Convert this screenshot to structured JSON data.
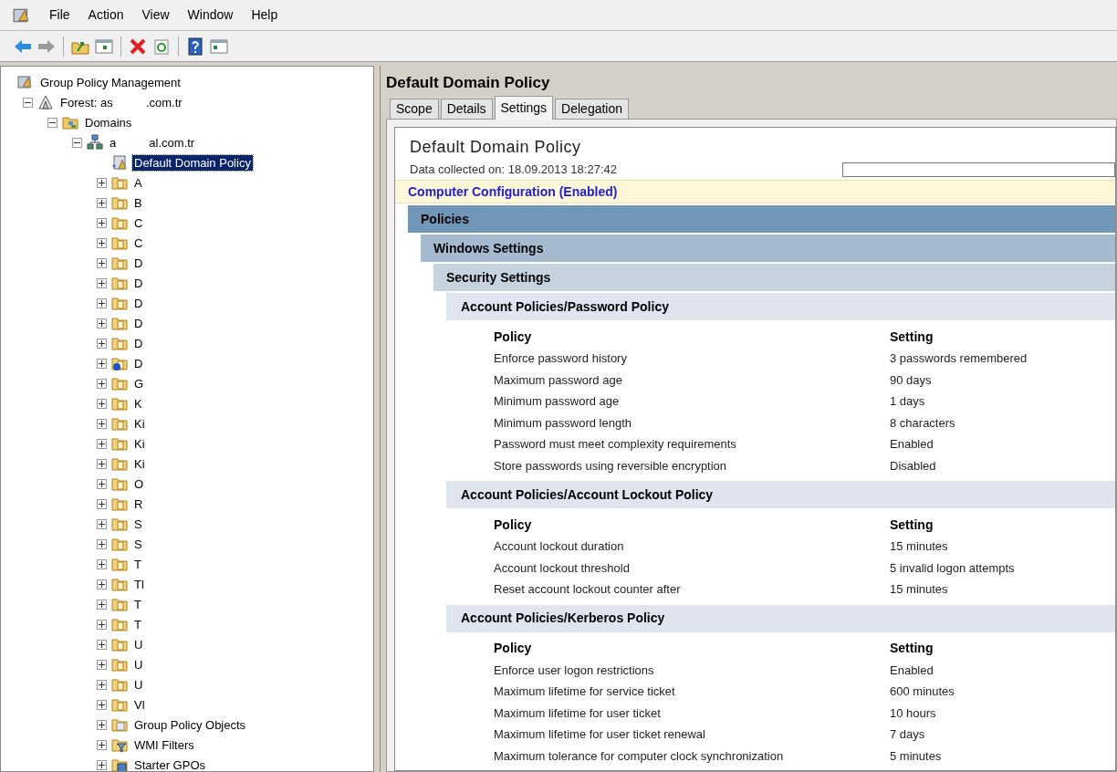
{
  "menu": [
    "File",
    "Action",
    "View",
    "Window",
    "Help"
  ],
  "tree": [
    {
      "label": "Group Policy Management",
      "kind": "root",
      "selected": false,
      "children": [
        {
          "label": "Forest: as          .com.tr",
          "kind": "forest",
          "expanded": true,
          "selected": false,
          "children": [
            {
              "label": "Domains",
              "kind": "domains",
              "expanded": true,
              "selected": false,
              "children": [
                {
                  "label": "a          al.com.tr",
                  "kind": "domain",
                  "expanded": true,
                  "selected": false,
                  "children": [
                    {
                      "label": "Default Domain Policy",
                      "kind": "gpo_link",
                      "selected": true
                    },
                    {
                      "label": "A",
                      "kind": "ou",
                      "expanded": false,
                      "selected": false
                    },
                    {
                      "label": "B",
                      "kind": "ou",
                      "expanded": false,
                      "selected": false
                    },
                    {
                      "label": "C",
                      "kind": "ou",
                      "expanded": false,
                      "selected": false
                    },
                    {
                      "label": "C",
                      "kind": "ou",
                      "expanded": false,
                      "selected": false
                    },
                    {
                      "label": "D",
                      "kind": "ou",
                      "expanded": false,
                      "selected": false
                    },
                    {
                      "label": "D",
                      "kind": "ou",
                      "expanded": false,
                      "selected": false
                    },
                    {
                      "label": "D",
                      "kind": "ou",
                      "expanded": false,
                      "selected": false
                    },
                    {
                      "label": "D",
                      "kind": "ou",
                      "expanded": false,
                      "selected": false
                    },
                    {
                      "label": "D",
                      "kind": "ou",
                      "expanded": false,
                      "selected": false
                    },
                    {
                      "label": "D",
                      "kind": "ou_info",
                      "expanded": false,
                      "selected": false
                    },
                    {
                      "label": "G",
                      "kind": "ou",
                      "expanded": false,
                      "selected": false
                    },
                    {
                      "label": "K",
                      "kind": "ou",
                      "expanded": false,
                      "selected": false
                    },
                    {
                      "label": "Ki",
                      "kind": "ou",
                      "expanded": false,
                      "selected": false
                    },
                    {
                      "label": "Ki",
                      "kind": "ou",
                      "expanded": false,
                      "selected": false
                    },
                    {
                      "label": "Ki",
                      "kind": "ou",
                      "expanded": false,
                      "selected": false
                    },
                    {
                      "label": "O",
                      "kind": "ou",
                      "expanded": false,
                      "selected": false
                    },
                    {
                      "label": "R",
                      "kind": "ou",
                      "expanded": false,
                      "selected": false
                    },
                    {
                      "label": "S",
                      "kind": "ou",
                      "expanded": false,
                      "selected": false
                    },
                    {
                      "label": "S",
                      "kind": "ou",
                      "expanded": false,
                      "selected": false
                    },
                    {
                      "label": "T",
                      "kind": "ou",
                      "expanded": false,
                      "selected": false
                    },
                    {
                      "label": "Tl",
                      "kind": "ou",
                      "expanded": false,
                      "selected": false
                    },
                    {
                      "label": "T",
                      "kind": "ou",
                      "expanded": false,
                      "selected": false
                    },
                    {
                      "label": "T",
                      "kind": "ou",
                      "expanded": false,
                      "selected": false
                    },
                    {
                      "label": "U",
                      "kind": "ou",
                      "expanded": false,
                      "selected": false
                    },
                    {
                      "label": "U",
                      "kind": "ou",
                      "expanded": false,
                      "selected": false
                    },
                    {
                      "label": "U",
                      "kind": "ou",
                      "expanded": false,
                      "selected": false
                    },
                    {
                      "label": "Vl",
                      "kind": "ou",
                      "expanded": false,
                      "selected": false
                    },
                    {
                      "label": "Group Policy Objects",
                      "kind": "gpo_folder",
                      "expanded": false,
                      "selected": false
                    },
                    {
                      "label": "WMI Filters",
                      "kind": "wmi",
                      "expanded": false,
                      "selected": false
                    },
                    {
                      "label": "Starter GPOs",
                      "kind": "starter",
                      "expanded": false,
                      "selected": false
                    }
                  ]
                }
              ]
            }
          ]
        }
      ]
    }
  ],
  "details": {
    "title": "Default Domain Policy",
    "tabs": [
      {
        "label": "Scope",
        "selected": false
      },
      {
        "label": "Details",
        "selected": false
      },
      {
        "label": "Settings",
        "selected": true
      },
      {
        "label": "Delegation",
        "selected": false
      }
    ],
    "report": {
      "title": "Default Domain Policy",
      "collected": "Data collected on: 18.09.2013 18:27:42",
      "configuration": "Computer Configuration (Enabled)",
      "headings": [
        "Policies",
        "Windows Settings",
        "Security Settings"
      ],
      "groups": [
        {
          "title": "Account Policies/Password Policy",
          "columns": [
            "Policy",
            "Setting"
          ],
          "rows": [
            [
              "Enforce password history",
              "3 passwords remembered"
            ],
            [
              "Maximum password age",
              "90 days"
            ],
            [
              "Minimum password age",
              "1 days"
            ],
            [
              "Minimum password length",
              "8 characters"
            ],
            [
              "Password must meet complexity requirements",
              "Enabled"
            ],
            [
              "Store passwords using reversible encryption",
              "Disabled"
            ]
          ]
        },
        {
          "title": "Account Policies/Account Lockout Policy",
          "columns": [
            "Policy",
            "Setting"
          ],
          "rows": [
            [
              "Account lockout duration",
              "15 minutes"
            ],
            [
              "Account lockout threshold",
              "5 invalid logon attempts"
            ],
            [
              "Reset account lockout counter after",
              "15 minutes"
            ]
          ]
        },
        {
          "title": "Account Policies/Kerberos Policy",
          "columns": [
            "Policy",
            "Setting"
          ],
          "rows": [
            [
              "Enforce user logon restrictions",
              "Enabled"
            ],
            [
              "Maximum lifetime for service ticket",
              "600 minutes"
            ],
            [
              "Maximum lifetime for user ticket",
              "10 hours"
            ],
            [
              "Maximum lifetime for user ticket renewal",
              "7 days"
            ],
            [
              "Maximum tolerance for computer clock synchronization",
              "5 minutes"
            ]
          ]
        }
      ]
    }
  }
}
